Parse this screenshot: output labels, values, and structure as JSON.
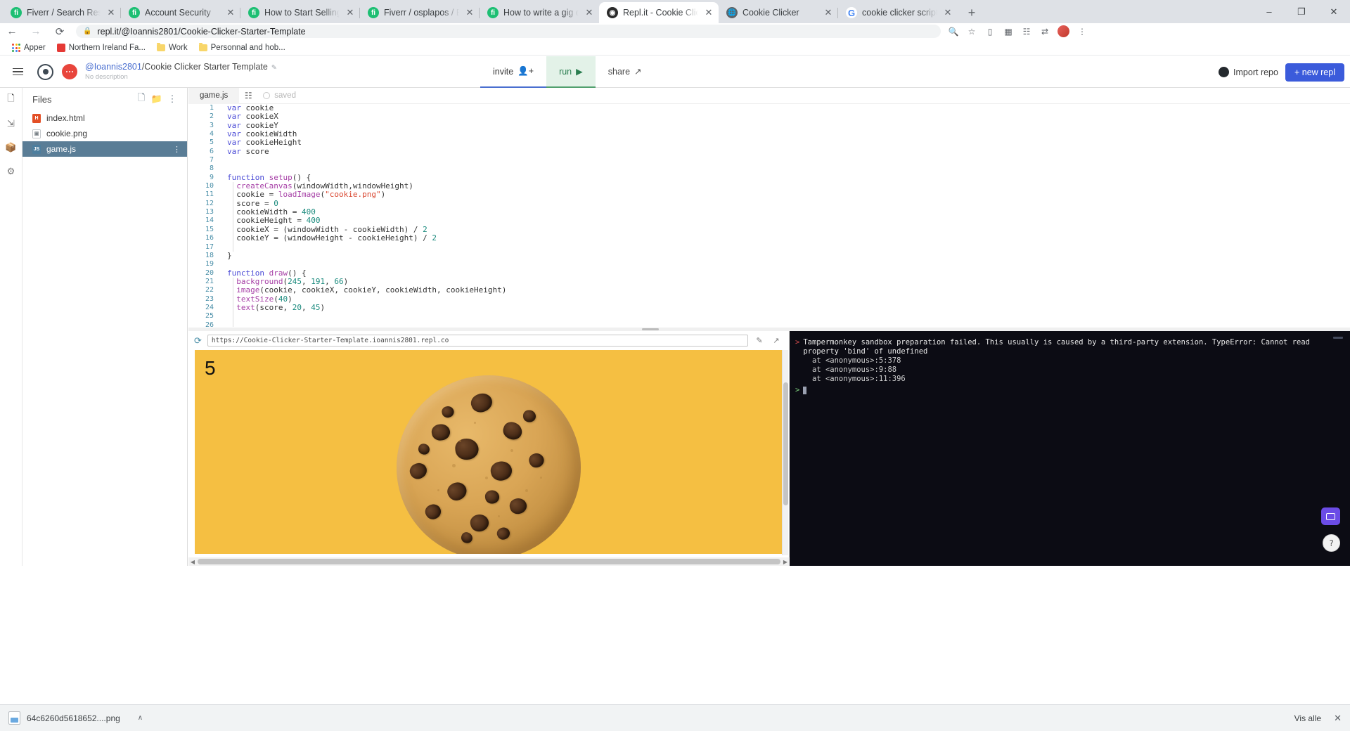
{
  "browser": {
    "tabs": [
      {
        "title": "Fiverr / Search Results for 'k",
        "favicon": "fiverr-icon",
        "active": false
      },
      {
        "title": "Account Security",
        "favicon": "fiverr-icon",
        "active": false
      },
      {
        "title": "How to Start Selling on Five",
        "favicon": "fiverr-icon",
        "active": false
      },
      {
        "title": "Fiverr / osplapos / Edit Gig",
        "favicon": "fiverr-icon",
        "active": false
      },
      {
        "title": "How to write a gig descripti",
        "favicon": "fiverr-icon",
        "active": false
      },
      {
        "title": "Repl.it - Cookie Clicker Start",
        "favicon": "replit-icon",
        "active": true
      },
      {
        "title": "Cookie Clicker",
        "favicon": "globe-icon",
        "active": false
      },
      {
        "title": "cookie clicker script - Goog",
        "favicon": "google-icon",
        "active": false
      }
    ],
    "new_tab_label": "+",
    "window_controls": {
      "minimize": "–",
      "maximize": "❐",
      "close": "✕"
    },
    "nav": {
      "back": "←",
      "forward": "→",
      "reload": "⟳"
    },
    "omnibox": {
      "url": "repl.it/@Ioannis2801/Cookie-Clicker-Starter-Template",
      "lock": "🔒"
    },
    "toolbar_icons": [
      "search-icon",
      "star-icon",
      "cast-icon",
      "extension-icon",
      "grid-icon",
      "translate-icon"
    ],
    "bookmarks": [
      {
        "label": "Apper",
        "icon": "apps-grid-icon"
      },
      {
        "label": "Northern Ireland Fa...",
        "icon": "site-icon"
      },
      {
        "label": "Work",
        "icon": "folder-icon"
      },
      {
        "label": "Personnal and hob...",
        "icon": "folder-icon"
      }
    ]
  },
  "replit": {
    "header": {
      "owner": "@Ioannis2801",
      "repl_name": "/Cookie Clicker Starter Template",
      "pencil": "✎",
      "description": "No description",
      "invite_label": "invite",
      "invite_icon": "👤+",
      "run_label": "run",
      "run_icon": "▶",
      "share_label": "share",
      "share_icon": "↗",
      "import_repo_label": "Import repo",
      "new_repl_label": "+ new repl"
    },
    "rail": [
      "files-icon",
      "share-icon",
      "packages-icon",
      "settings-icon"
    ],
    "files": {
      "title": "Files",
      "head_icons": [
        "add-file-icon",
        "add-folder-icon",
        "kebab-menu-icon"
      ],
      "items": [
        {
          "name": "index.html",
          "type": "html",
          "badge": "H",
          "selected": false
        },
        {
          "name": "cookie.png",
          "type": "png",
          "badge": "▣",
          "selected": false
        },
        {
          "name": "game.js",
          "type": "js",
          "badge": "JS",
          "selected": true
        }
      ]
    },
    "editor": {
      "tab_label": "game.js",
      "format_icon": "format-icon",
      "saved_label": "saved",
      "lines": [
        {
          "n": 1,
          "tokens": [
            [
              "k-kw",
              "var"
            ],
            [
              "k-plain",
              " cookie"
            ]
          ]
        },
        {
          "n": 2,
          "tokens": [
            [
              "k-kw",
              "var"
            ],
            [
              "k-plain",
              " cookieX"
            ]
          ]
        },
        {
          "n": 3,
          "tokens": [
            [
              "k-kw",
              "var"
            ],
            [
              "k-plain",
              " cookieY"
            ]
          ]
        },
        {
          "n": 4,
          "tokens": [
            [
              "k-kw",
              "var"
            ],
            [
              "k-plain",
              " cookieWidth"
            ]
          ]
        },
        {
          "n": 5,
          "tokens": [
            [
              "k-kw",
              "var"
            ],
            [
              "k-plain",
              " cookieHeight"
            ]
          ]
        },
        {
          "n": 6,
          "tokens": [
            [
              "k-kw",
              "var"
            ],
            [
              "k-plain",
              " score"
            ]
          ]
        },
        {
          "n": 7,
          "tokens": []
        },
        {
          "n": 8,
          "tokens": []
        },
        {
          "n": 9,
          "tokens": [
            [
              "k-kw",
              "function"
            ],
            [
              "k-plain",
              " "
            ],
            [
              "k-fn",
              "setup"
            ],
            [
              "k-plain",
              "() {"
            ]
          ]
        },
        {
          "n": 10,
          "tokens": [
            [
              "k-plain",
              "  "
            ],
            [
              "k-fn",
              "createCanvas"
            ],
            [
              "k-plain",
              "(windowWidth,windowHeight)"
            ]
          ]
        },
        {
          "n": 11,
          "tokens": [
            [
              "k-plain",
              "  cookie = "
            ],
            [
              "k-fn",
              "loadImage"
            ],
            [
              "k-plain",
              "("
            ],
            [
              "k-str",
              "\"cookie.png\""
            ],
            [
              "k-plain",
              ")"
            ]
          ]
        },
        {
          "n": 12,
          "tokens": [
            [
              "k-plain",
              "  score = "
            ],
            [
              "k-num",
              "0"
            ]
          ]
        },
        {
          "n": 13,
          "tokens": [
            [
              "k-plain",
              "  cookieWidth = "
            ],
            [
              "k-num",
              "400"
            ]
          ]
        },
        {
          "n": 14,
          "tokens": [
            [
              "k-plain",
              "  cookieHeight = "
            ],
            [
              "k-num",
              "400"
            ]
          ]
        },
        {
          "n": 15,
          "tokens": [
            [
              "k-plain",
              "  cookieX = (windowWidth - cookieWidth) / "
            ],
            [
              "k-num",
              "2"
            ]
          ]
        },
        {
          "n": 16,
          "tokens": [
            [
              "k-plain",
              "  cookieY = (windowHeight - cookieHeight) / "
            ],
            [
              "k-num",
              "2"
            ]
          ]
        },
        {
          "n": 17,
          "tokens": []
        },
        {
          "n": 18,
          "tokens": [
            [
              "k-plain",
              "}"
            ]
          ]
        },
        {
          "n": 19,
          "tokens": []
        },
        {
          "n": 20,
          "tokens": [
            [
              "k-kw",
              "function"
            ],
            [
              "k-plain",
              " "
            ],
            [
              "k-fn",
              "draw"
            ],
            [
              "k-plain",
              "() {"
            ]
          ]
        },
        {
          "n": 21,
          "tokens": [
            [
              "k-plain",
              "  "
            ],
            [
              "k-fn",
              "background"
            ],
            [
              "k-plain",
              "("
            ],
            [
              "k-num",
              "245"
            ],
            [
              "k-plain",
              ", "
            ],
            [
              "k-num",
              "191"
            ],
            [
              "k-plain",
              ", "
            ],
            [
              "k-num",
              "66"
            ],
            [
              "k-plain",
              ")"
            ]
          ]
        },
        {
          "n": 22,
          "tokens": [
            [
              "k-plain",
              "  "
            ],
            [
              "k-fn",
              "image"
            ],
            [
              "k-plain",
              "(cookie, cookieX, cookieY, cookieWidth, cookieHeight)"
            ]
          ]
        },
        {
          "n": 23,
          "tokens": [
            [
              "k-plain",
              "  "
            ],
            [
              "k-fn",
              "textSize"
            ],
            [
              "k-plain",
              "("
            ],
            [
              "k-num",
              "40"
            ],
            [
              "k-plain",
              ")"
            ]
          ]
        },
        {
          "n": 24,
          "tokens": [
            [
              "k-plain",
              "  "
            ],
            [
              "k-fn",
              "text"
            ],
            [
              "k-plain",
              "(score, "
            ],
            [
              "k-num",
              "20"
            ],
            [
              "k-plain",
              ", "
            ],
            [
              "k-num",
              "45"
            ],
            [
              "k-plain",
              ")"
            ]
          ]
        },
        {
          "n": 25,
          "tokens": []
        },
        {
          "n": 26,
          "tokens": []
        }
      ]
    },
    "preview": {
      "refresh_icon": "refresh-icon",
      "url": "https://Cookie-Clicker-Starter-Template.ioannis2801.repl.co",
      "edit_icon": "✎",
      "popout_icon": "↗",
      "score": "5",
      "canvas_bg": "#f5bf42"
    },
    "console": {
      "error_prefix": ">",
      "error_text": "Tampermonkey sandbox preparation failed. This usually is caused by a third-party extension. TypeError: Cannot read property 'bind' of undefined",
      "stack": [
        "at <anonymous>:5:378",
        "at <anonymous>:9:88",
        "at <anonymous>:11:396"
      ],
      "prompt_arrow": ">",
      "chat_icon": "chat-icon",
      "help_icon": "?"
    }
  },
  "downloads": {
    "file_name": "64c6260d5618652....png",
    "chevron": "∧",
    "show_all_label": "Vis alle",
    "close_label": "✕"
  }
}
